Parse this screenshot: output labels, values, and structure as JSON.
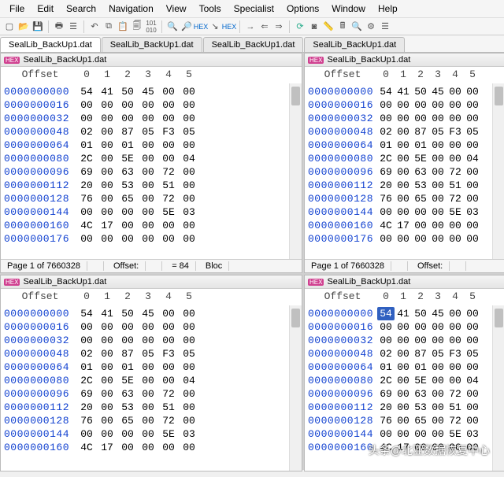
{
  "menubar": [
    "File",
    "Edit",
    "Search",
    "Navigation",
    "View",
    "Tools",
    "Specialist",
    "Options",
    "Window",
    "Help"
  ],
  "tabs": [
    {
      "label": "SealLib_BackUp1.dat",
      "active": true
    },
    {
      "label": "SealLib_BackUp1.dat",
      "active": false
    },
    {
      "label": "SealLib_BackUp1.dat",
      "active": false
    },
    {
      "label": "SealLib_BackUp1.dat",
      "active": false
    }
  ],
  "panel_header": {
    "offset_label": "Offset",
    "cols": [
      "0",
      "1",
      "2",
      "3",
      "4",
      "5"
    ]
  },
  "panel_title": "SealLib_BackUp1.dat",
  "hex_badge": "HEX",
  "status_row1": {
    "left": "Page 1 of 7660328",
    "mid": "Offset:",
    "eq": "= 84",
    "bloc": "Bloc"
  },
  "status_row2": {
    "left": "Page 1 of 7660328",
    "mid": "Offset:"
  },
  "hex_rows": [
    {
      "off": "0000000000",
      "b": [
        "54",
        "41",
        "50",
        "45",
        "00",
        "00"
      ]
    },
    {
      "off": "0000000016",
      "b": [
        "00",
        "00",
        "00",
        "00",
        "00",
        "00"
      ]
    },
    {
      "off": "0000000032",
      "b": [
        "00",
        "00",
        "00",
        "00",
        "00",
        "00"
      ]
    },
    {
      "off": "0000000048",
      "b": [
        "02",
        "00",
        "87",
        "05",
        "F3",
        "05"
      ]
    },
    {
      "off": "0000000064",
      "b": [
        "01",
        "00",
        "01",
        "00",
        "00",
        "00"
      ]
    },
    {
      "off": "0000000080",
      "b": [
        "2C",
        "00",
        "5E",
        "00",
        "00",
        "04"
      ]
    },
    {
      "off": "0000000096",
      "b": [
        "69",
        "00",
        "63",
        "00",
        "72",
        "00"
      ]
    },
    {
      "off": "0000000112",
      "b": [
        "20",
        "00",
        "53",
        "00",
        "51",
        "00"
      ]
    },
    {
      "off": "0000000128",
      "b": [
        "76",
        "00",
        "65",
        "00",
        "72",
        "00"
      ]
    },
    {
      "off": "0000000144",
      "b": [
        "00",
        "00",
        "00",
        "00",
        "5E",
        "03"
      ]
    },
    {
      "off": "0000000160",
      "b": [
        "4C",
        "17",
        "00",
        "00",
        "00",
        "00"
      ]
    },
    {
      "off": "0000000176",
      "b": [
        "00",
        "00",
        "00",
        "00",
        "00",
        "00"
      ]
    }
  ],
  "watermark": "头条@北亚数据恢复中心",
  "selected": {
    "panel_index": 3,
    "row": 0,
    "col": 0
  }
}
